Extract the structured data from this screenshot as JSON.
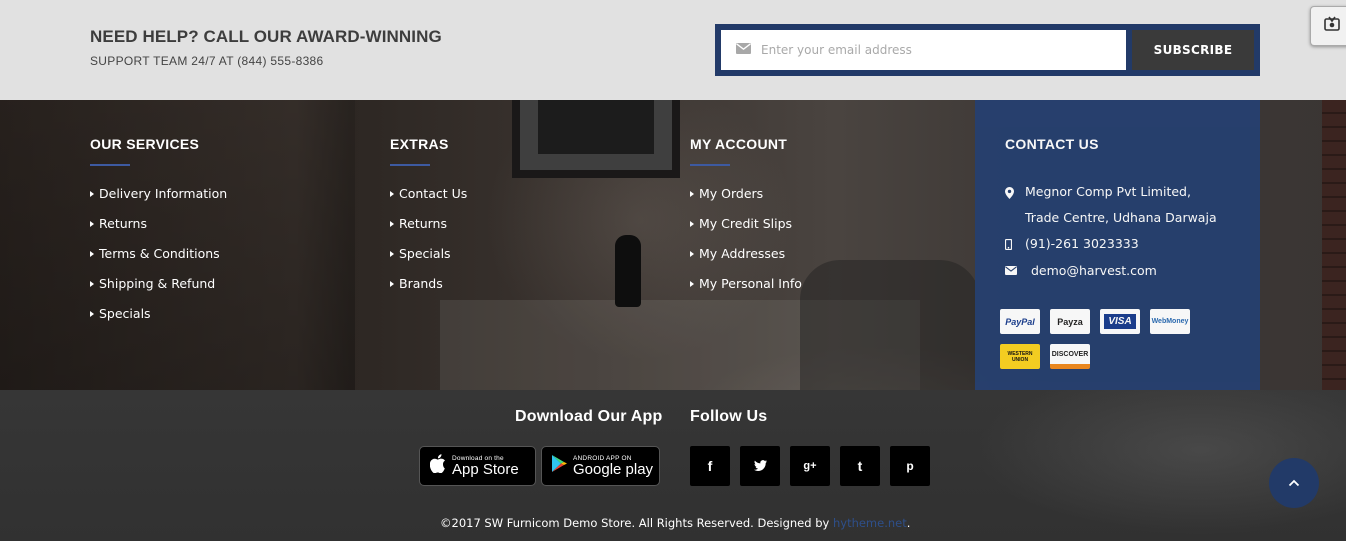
{
  "help": {
    "title": "NEED HELP? CALL OUR AWARD-WINNING",
    "subtitle": "SUPPORT TEAM 24/7 AT (844) 555-8386"
  },
  "newsletter": {
    "placeholder": "Enter your email address",
    "button_label": "SUBSCRIBE"
  },
  "columns": {
    "services": {
      "title": "OUR SERVICES",
      "links": [
        "Delivery Information",
        "Returns",
        "Terms & Conditions",
        "Shipping & Refund",
        "Specials"
      ]
    },
    "extras": {
      "title": "EXTRAS",
      "links": [
        "Contact Us",
        "Returns",
        "Specials",
        "Brands"
      ]
    },
    "account": {
      "title": "MY ACCOUNT",
      "links": [
        "My Orders",
        "My Credit Slips",
        "My Addresses",
        "My Personal Info"
      ]
    }
  },
  "contact": {
    "title": "CONTACT US",
    "address_line1": "Megnor Comp Pvt Limited,",
    "address_line2": "Trade Centre, Udhana Darwaja",
    "phone": "(91)-261 3023333",
    "email": "demo@harvest.com",
    "payments": [
      "PayPal",
      "Payza",
      "VISA",
      "WebMoney",
      "WESTERN UNION",
      "DISCOVER"
    ]
  },
  "app": {
    "title": "Download Our App",
    "appstore_small": "Download on the",
    "appstore_big": "App Store",
    "googleplay_small": "ANDROID APP ON",
    "googleplay_big": "Google play"
  },
  "social": {
    "title": "Follow Us",
    "icons": [
      "facebook-icon",
      "twitter-icon",
      "google-plus-icon",
      "tumblr-icon",
      "pinterest-icon"
    ]
  },
  "copyright": {
    "text": "©2017 SW Furnicom Demo Store. All Rights Reserved. Designed by ",
    "link": "hytheme.net",
    "end": "."
  },
  "colors": {
    "accent_navy": "#223a68",
    "contact_panel": "#26406f",
    "help_band": "#e1e1e1"
  }
}
